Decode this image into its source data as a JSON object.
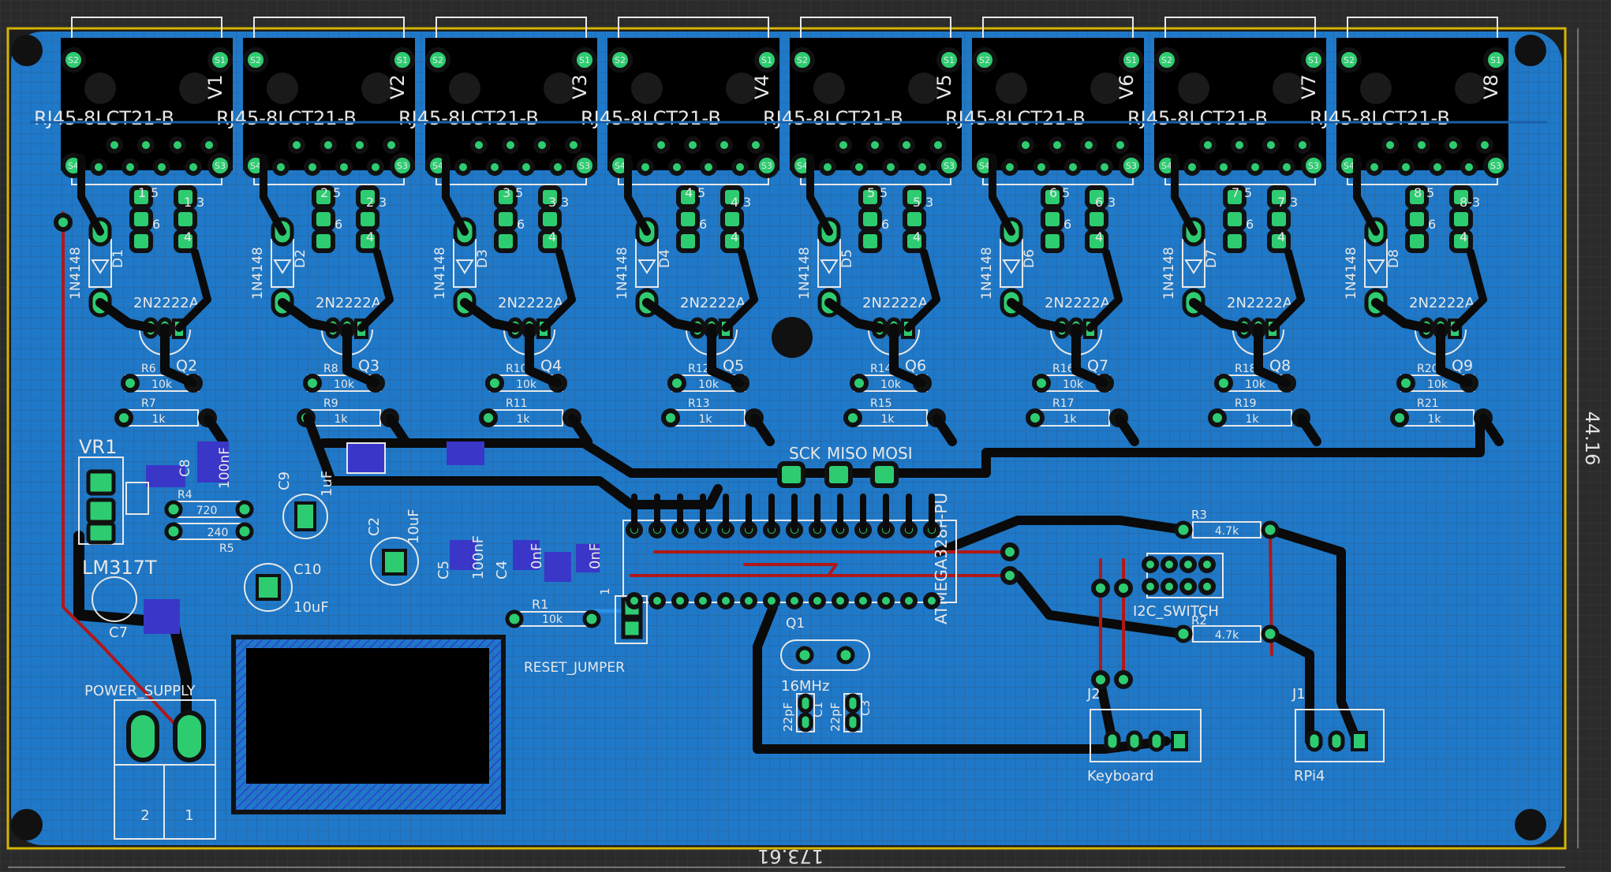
{
  "colors": {
    "background": "#2b2b2b",
    "grid": "#3a3a3a",
    "board_fill": "#1f78c8",
    "board_edge": "#d4b400",
    "copper_trace": "#0a0a0a",
    "top_trace": "#b01818",
    "pad": "#2ecc71",
    "silk": "#e8e8e8",
    "smd_pad": "#3a36c8"
  },
  "board": {
    "width_label": "173.61",
    "height_label": "44.16"
  },
  "rj45_modules": [
    {
      "part": "RJ45-8LCT21-B",
      "voltage": "V1",
      "diode": "D1",
      "transistor": "Q2",
      "r_top": "R6",
      "r_bottom": "R7",
      "pins": [
        "1",
        "5",
        "1",
        "3"
      ]
    },
    {
      "part": "RJ45-8LCT21-B",
      "voltage": "V2",
      "diode": "D2",
      "transistor": "Q3",
      "r_top": "R8",
      "r_bottom": "R9",
      "pins": [
        "2",
        "5",
        "2",
        "3"
      ]
    },
    {
      "part": "RJ45-8LCT21-B",
      "voltage": "V3",
      "diode": "D3",
      "transistor": "Q4",
      "r_top": "R10",
      "r_bottom": "R11",
      "pins": [
        "3",
        "5",
        "3",
        "3"
      ]
    },
    {
      "part": "RJ45-8LCT21-B",
      "voltage": "V4",
      "diode": "D4",
      "transistor": "Q5",
      "r_top": "R12",
      "r_bottom": "R13",
      "pins": [
        "4",
        "5",
        "4",
        "3"
      ]
    },
    {
      "part": "RJ45-8LCT21-B",
      "voltage": "V5",
      "diode": "D5",
      "transistor": "Q6",
      "r_top": "R14",
      "r_bottom": "R15",
      "pins": [
        "5",
        "5",
        "5",
        "3"
      ]
    },
    {
      "part": "RJ45-8LCT21-B",
      "voltage": "V6",
      "diode": "D6",
      "transistor": "Q7",
      "r_top": "R16",
      "r_bottom": "R17",
      "pins": [
        "6",
        "5",
        "6",
        "3"
      ]
    },
    {
      "part": "RJ45-8LCT21-B",
      "voltage": "V7",
      "diode": "D7",
      "transistor": "Q8",
      "r_top": "R18",
      "r_bottom": "R19",
      "pins": [
        "7",
        "5",
        "7",
        "3"
      ]
    },
    {
      "part": "RJ45-8LCT21-B",
      "voltage": "V8",
      "diode": "D8",
      "transistor": "Q9",
      "r_top": "R20",
      "r_bottom": "R21",
      "pins": [
        "8",
        "5",
        "8-3",
        ""
      ]
    }
  ],
  "module_labels": {
    "diode_part": "1N4148",
    "transistor_part": "2N2222A",
    "r_top_value": "10k",
    "r_bottom_value": "1k",
    "pad_s1": "S1",
    "pad_s2": "S2",
    "pad_s3": "S3",
    "pad_s4": "S4",
    "pin6": "6",
    "pin4": "4"
  },
  "regulator": {
    "vr": "VR1",
    "part": "LM317T",
    "r4_value": "720",
    "r5_value": "240",
    "r4": "R4",
    "r5": "R5",
    "c8": "C8",
    "c8_value": "100nF",
    "c9": "C9",
    "c9_value": "1uF",
    "c10": "C10",
    "c10_value": "10uF",
    "c7": "C7"
  },
  "caps": {
    "c2": "C2",
    "c2_value": "10uF",
    "c5": "C5",
    "c5_value": "100nF",
    "c4": "C4",
    "c4_value": "0nF",
    "c6_value": "0nF",
    "c1": "C1",
    "c1_value": "22pF",
    "c3": "C3",
    "c3_value": "22pF"
  },
  "mcu": {
    "part": "ATMEGA328P-PU",
    "r1": "R1",
    "r1_value": "10k",
    "reset": "RESET_JUMPER",
    "pin1": "1",
    "crystal": "Q1",
    "crystal_value": "16MHz",
    "isp": [
      "SCK",
      "MISO",
      "MOSI"
    ]
  },
  "i2c": {
    "switch": "I2C_SWITCH",
    "r3": "R3",
    "r3_value": "4.7k",
    "r2": "R2",
    "r2_value": "4.7k",
    "j2": "J2",
    "j2_name": "Keyboard",
    "j1": "J1",
    "j1_name": "RPi4"
  },
  "power": {
    "label": "POWER_SUPPLY",
    "pin2": "2",
    "pin1": "1"
  }
}
